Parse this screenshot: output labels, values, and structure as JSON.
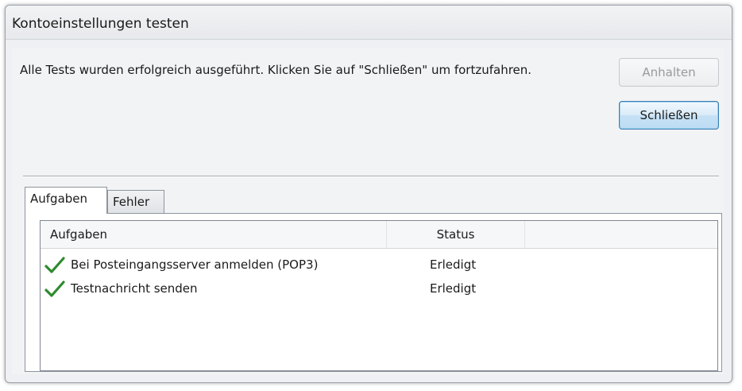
{
  "window": {
    "title": "Kontoeinstellungen testen"
  },
  "message": "Alle Tests wurden erfolgreich ausgeführt. Klicken Sie auf \"Schließen\" um fortzufahren.",
  "buttons": {
    "stop_label": "Anhalten",
    "close_label": "Schließen"
  },
  "tabs": [
    {
      "label": "Aufgaben",
      "active": true
    },
    {
      "label": "Fehler",
      "active": false
    }
  ],
  "table": {
    "columns": [
      "Aufgaben",
      "Status"
    ],
    "rows": [
      {
        "icon": "checkmark-icon",
        "task": "Bei Posteingangsserver anmelden (POP3)",
        "status": "Erledigt"
      },
      {
        "icon": "checkmark-icon",
        "task": "Testnachricht senden",
        "status": "Erledigt"
      }
    ]
  },
  "colors": {
    "checkmark": "#2e8b2e",
    "default_button_border": "#3c7fb1"
  }
}
